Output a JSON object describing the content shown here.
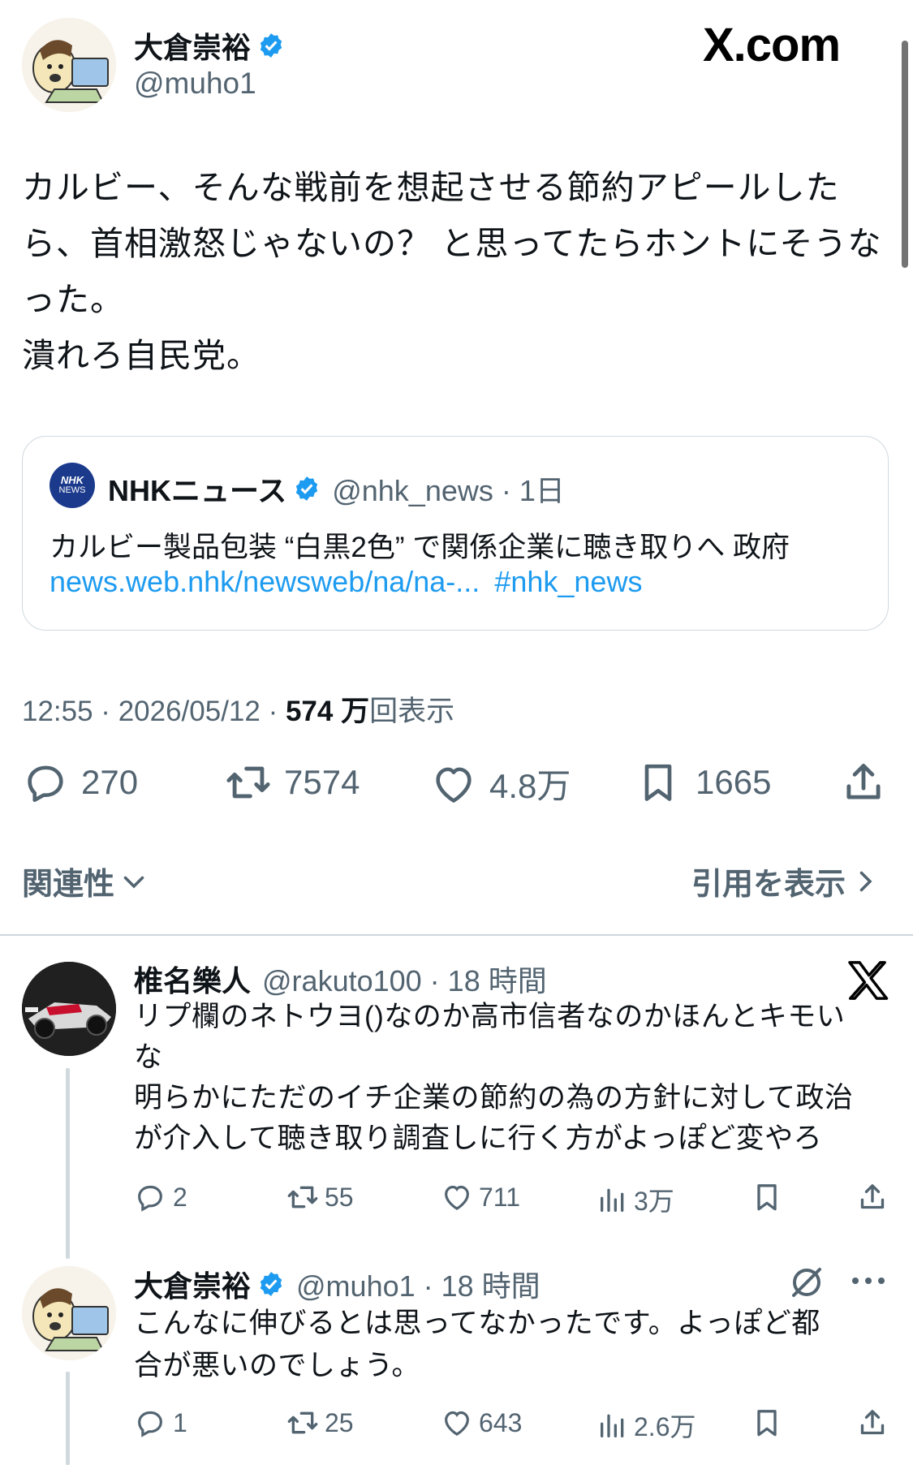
{
  "main_post": {
    "author": {
      "display_name": "大倉崇裕",
      "handle": "@muho1",
      "verified": true
    },
    "brand_logo": "X.com",
    "text_lines": [
      "カルビー、そんな戦前を想起させる節約アピールした",
      "ら、首相激怒じゃないの？ と思ってたらホントにそうな",
      "った。",
      "潰れろ自民党。"
    ],
    "quote": {
      "avatar_label_top": "NHK",
      "avatar_label_bottom": "NEWS",
      "display_name": "NHKニュース",
      "handle_time": "@nhk_news · 1日",
      "text": "カルビー製品包装 “白黒2色” で関係企業に聴き取りへ 政府",
      "link_text": "news.web.nhk/newsweb/na/na-...",
      "hashtag": "#nhk_news"
    },
    "meta": {
      "time_date": "12:55 · 2026/05/12 · ",
      "views_count": "574 万",
      "views_label": "回表示"
    },
    "stats": {
      "replies": "270",
      "reposts": "7574",
      "likes": "4.8万",
      "bookmarks": "1665"
    },
    "sort_label": "関連性",
    "quotes_link": "引用を表示"
  },
  "replies": [
    {
      "display_name": "椎名樂人",
      "handle_time": "@rakuto100 · 18 時間",
      "text_lines": [
        "リプ欄のネトウヨ()なのか高市信者なのかほんとキモい",
        "な",
        "明らかにただのイチ企業の節約の為の方針に対して政治",
        "が介入して聴き取り調査しに行く方がよっぽど変やろ"
      ],
      "stats": {
        "replies": "2",
        "reposts": "55",
        "likes": "711",
        "views": "3万"
      }
    },
    {
      "display_name": "大倉崇裕",
      "handle_time": "@muho1 · 18 時間",
      "verified": true,
      "text_lines": [
        "こんなに伸びるとは思ってなかったです。よっぽど都",
        "合が悪いのでしょう。"
      ],
      "stats": {
        "replies": "1",
        "reposts": "25",
        "likes": "643",
        "views": "2.6万"
      }
    }
  ],
  "colors": {
    "text": "#0f1419",
    "muted": "#536471",
    "link": "#1d9bf0",
    "verified": "#1d9bf0",
    "border": "#cfd9de"
  }
}
